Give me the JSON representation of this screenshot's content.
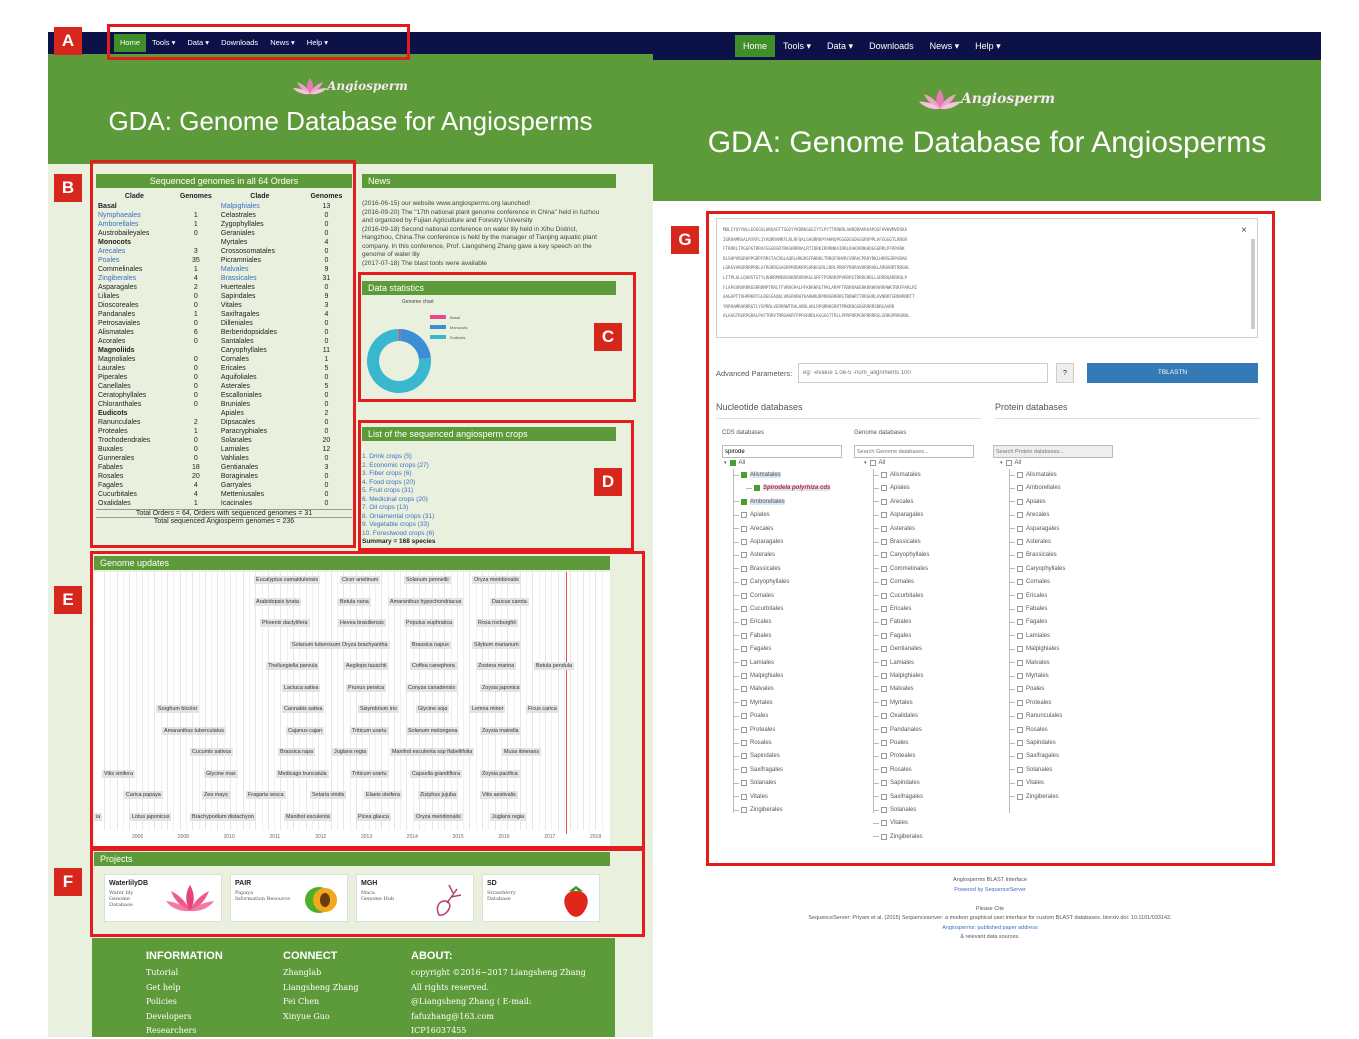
{
  "tags": [
    "A",
    "B",
    "C",
    "D",
    "E",
    "F",
    "G"
  ],
  "nav": {
    "items": [
      "Home",
      "Tools ▾",
      "Data ▾",
      "Downloads",
      "News ▾",
      "Help ▾"
    ],
    "active": "Home"
  },
  "header": {
    "logo_text": "Angiosperm",
    "title": "GDA: Genome Database for Angiosperms"
  },
  "genomes": {
    "title": "Sequenced genomes in all 64 Orders",
    "col_headers": [
      "Clade",
      "Genomes",
      "Clade",
      "Genomes"
    ],
    "left": [
      {
        "n": "Basal",
        "v": "",
        "type": "group"
      },
      {
        "n": "Nymphaeales",
        "v": "1",
        "type": "link"
      },
      {
        "n": "Amborellales",
        "v": "1",
        "type": "link"
      },
      {
        "n": "Austrobaileyales",
        "v": "0",
        "type": "plain"
      },
      {
        "n": "Monocots",
        "v": "",
        "type": "group"
      },
      {
        "n": "Arecales",
        "v": "3",
        "type": "link"
      },
      {
        "n": "Poales",
        "v": "35",
        "type": "link"
      },
      {
        "n": "Commelinales",
        "v": "1",
        "type": "plain"
      },
      {
        "n": "Zingiberales",
        "v": "4",
        "type": "link"
      },
      {
        "n": "Asparagales",
        "v": "2",
        "type": "plain"
      },
      {
        "n": "Liliales",
        "v": "0",
        "type": "plain"
      },
      {
        "n": "Dioscoreales",
        "v": "0",
        "type": "plain"
      },
      {
        "n": "Pandanales",
        "v": "1",
        "type": "plain"
      },
      {
        "n": "Petrosaviales",
        "v": "0",
        "type": "plain"
      },
      {
        "n": "Alismatales",
        "v": "6",
        "type": "plain"
      },
      {
        "n": "Acorales",
        "v": "0",
        "type": "plain"
      },
      {
        "n": "Magnoliids",
        "v": "",
        "type": "group"
      },
      {
        "n": "Magnoliales",
        "v": "0",
        "type": "plain"
      },
      {
        "n": "Laurales",
        "v": "0",
        "type": "plain"
      },
      {
        "n": "Piperales",
        "v": "0",
        "type": "plain"
      },
      {
        "n": "Canellales",
        "v": "0",
        "type": "plain"
      },
      {
        "n": "Ceratophyllales",
        "v": "0",
        "type": "plain"
      },
      {
        "n": "Chloranthales",
        "v": "0",
        "type": "plain"
      },
      {
        "n": "Eudicots",
        "v": "",
        "type": "group"
      },
      {
        "n": "Ranunculales",
        "v": "2",
        "type": "plain"
      },
      {
        "n": "Proteales",
        "v": "1",
        "type": "plain"
      },
      {
        "n": "Trochodendrales",
        "v": "0",
        "type": "plain"
      },
      {
        "n": "Buxales",
        "v": "0",
        "type": "plain"
      },
      {
        "n": "Gunnerales",
        "v": "0",
        "type": "plain"
      },
      {
        "n": "Fabales",
        "v": "18",
        "type": "plain"
      },
      {
        "n": "Rosales",
        "v": "20",
        "type": "plain"
      },
      {
        "n": "Fagales",
        "v": "4",
        "type": "plain"
      },
      {
        "n": "Cucurbitales",
        "v": "4",
        "type": "plain"
      },
      {
        "n": "Oxalidales",
        "v": "1",
        "type": "plain"
      }
    ],
    "right": [
      {
        "n": "Malpighiales",
        "v": "13",
        "type": "link"
      },
      {
        "n": "Celastrales",
        "v": "0",
        "type": "plain"
      },
      {
        "n": "Zygophyllales",
        "v": "0",
        "type": "plain"
      },
      {
        "n": "Geraniales",
        "v": "0",
        "type": "plain"
      },
      {
        "n": "Myrtales",
        "v": "4",
        "type": "plain"
      },
      {
        "n": "Crossosomatales",
        "v": "0",
        "type": "plain"
      },
      {
        "n": "Picramniales",
        "v": "0",
        "type": "plain"
      },
      {
        "n": "Malvales",
        "v": "9",
        "type": "link"
      },
      {
        "n": "Brassicales",
        "v": "31",
        "type": "link"
      },
      {
        "n": "Huerteales",
        "v": "0",
        "type": "plain"
      },
      {
        "n": "Sapindales",
        "v": "9",
        "type": "plain"
      },
      {
        "n": "Vitales",
        "v": "3",
        "type": "plain"
      },
      {
        "n": "Saxifragales",
        "v": "4",
        "type": "plain"
      },
      {
        "n": "Dilleniales",
        "v": "0",
        "type": "plain"
      },
      {
        "n": "Berberidopsidales",
        "v": "0",
        "type": "plain"
      },
      {
        "n": "Santalales",
        "v": "0",
        "type": "plain"
      },
      {
        "n": "Caryophyllales",
        "v": "11",
        "type": "plain"
      },
      {
        "n": "Cornales",
        "v": "1",
        "type": "plain"
      },
      {
        "n": "Ericales",
        "v": "5",
        "type": "plain"
      },
      {
        "n": "Aquifoliales",
        "v": "0",
        "type": "plain"
      },
      {
        "n": "Asterales",
        "v": "5",
        "type": "plain"
      },
      {
        "n": "Escalloniales",
        "v": "0",
        "type": "plain"
      },
      {
        "n": "Bruniales",
        "v": "0",
        "type": "plain"
      },
      {
        "n": "Apiales",
        "v": "2",
        "type": "plain"
      },
      {
        "n": "Dipsacales",
        "v": "0",
        "type": "plain"
      },
      {
        "n": "Paracryphiales",
        "v": "0",
        "type": "plain"
      },
      {
        "n": "Solanales",
        "v": "20",
        "type": "plain"
      },
      {
        "n": "Lamiales",
        "v": "12",
        "type": "plain"
      },
      {
        "n": "Vahliales",
        "v": "0",
        "type": "plain"
      },
      {
        "n": "Gentianales",
        "v": "3",
        "type": "plain"
      },
      {
        "n": "Boraginales",
        "v": "0",
        "type": "plain"
      },
      {
        "n": "Garryales",
        "v": "0",
        "type": "plain"
      },
      {
        "n": "Metteniusales",
        "v": "0",
        "type": "plain"
      },
      {
        "n": "Icacinales",
        "v": "0",
        "type": "plain"
      }
    ],
    "total_orders": "Total Orders = 64, Orders with sequenced genomes = 31",
    "total_genomes": "Total sequenced Angiosperm genomes = 236"
  },
  "news": {
    "title": "News",
    "lines": [
      "(2016-06-15) our website www.angiosperms.org launched!",
      "(2016-09-20) The \"17th national plant genome conference in China\" held in fuzhou",
      "and organized by Fujian Agriculture and Forestry University",
      "(2016-09-18) Second national conference on water lily held in Xihu District,",
      "Hangzhou, China.The conference is held by the manager of Tianjing aquatic plant",
      "company. In this conference, Prof. Liangsheng Zhang gave a key speech on the",
      "genome of water lily",
      "(2017-07-18) The blast tools were available"
    ]
  },
  "stats": {
    "title": "Data statistics",
    "chart_title": "Genome chart",
    "legend": [
      "Basal",
      "Monocots",
      "Eudicots"
    ]
  },
  "chart_data": {
    "type": "pie",
    "title": "Genome chart",
    "labels": [
      "Basal",
      "Monocots",
      "Eudicots"
    ],
    "values": [
      2,
      52,
      176
    ],
    "colors": [
      "#e8488a",
      "#3a8fd6",
      "#39b7cf"
    ]
  },
  "crops": {
    "title": "List of the sequenced angiosperm crops",
    "items": [
      "1. Drink crops (5)",
      "2. Economic crops (27)",
      "3. Fiber crops (6)",
      "4. Food crops (20)",
      "5. Fruit crops (31)",
      "6. Medicinal crops (20)",
      "7. Oil crops (13)",
      "8. Ornamental crops (31)",
      "9. Vegetable crops (33)",
      "10. Forestwood crops (6)"
    ],
    "summary": "Summary = 168 species"
  },
  "updates": {
    "title": "Genome updates",
    "species": [
      "Eucalyptus camaldulensis",
      "Cicer arietinum",
      "Solanum pennellii",
      "Oryza meridionalis",
      "Arabidopsis lyrata",
      "Betula nana",
      "Amaranthus hypochondriacus",
      "Daucus carota",
      "Phoenix dactylifera",
      "Hevea brasiliensis",
      "Populus euphratica",
      "Rosa roxburghii",
      "Solanum tuberosum",
      "Oryza brachyantha",
      "Brassica napus",
      "Silybum marianum",
      "Thellungiella parvula",
      "Aegilops tauschii",
      "Coffea canephora",
      "Zostera marina",
      "Betula pendula",
      "Lactuca sativa",
      "Prunus persica",
      "Conyza canadensis",
      "Zoysia japonica",
      "Sorghum bicolor",
      "Cannabis sativa",
      "Sisymbrium irio",
      "Glycine soja",
      "Lemna minor",
      "Ficus carica",
      "Amaranthus tuberculatus",
      "Cajanus cajan",
      "Triticum urartu",
      "Solanum melongena",
      "Zoysia matrella",
      "Cucumis sativus",
      "Brassica rapa",
      "Juglans regia",
      "Manihot esculenta ssp flabellifolia",
      "Musa itinerans",
      "Vitis vinifera",
      "Glycine max",
      "Medicago truncatula",
      "Triticum urartu",
      "Capsella grandiflora",
      "Zoysia pacifica",
      "Carica papaya",
      "Zea mays",
      "Fragaria vesca",
      "Setaria viridis",
      "Elaeis oleifera",
      "Ziziphus jujuba",
      "Vitis aestivalis",
      "ia",
      "Lotus japonicus",
      "Brachypodium distachyon",
      "Manihot esculenta",
      "Picea glauca",
      "Oryza meridionalis",
      "Juglans regia"
    ],
    "years": [
      "2006",
      "2008",
      "2010",
      "2011",
      "2012",
      "2013",
      "2014",
      "2015",
      "2016",
      "2017",
      "2018"
    ]
  },
  "projects": {
    "title": "Projects",
    "items": [
      {
        "name": "WaterlilyDB",
        "desc": "Water lily\nGenome\nDatabase",
        "icon": "lotus-icon"
      },
      {
        "name": "PAIR",
        "desc": "Papaya\nInformation Resource",
        "icon": "papaya-icon"
      },
      {
        "name": "MGH",
        "desc": "Maca\nGenome Hub",
        "icon": "maca-icon"
      },
      {
        "name": "SD",
        "desc": "Strawberry\nDatabase",
        "icon": "strawberry-icon"
      }
    ]
  },
  "footer": {
    "info_title": "INFORMATION",
    "info": [
      "Tutorial",
      "Get help",
      "Policies",
      "Developers",
      "Researchers"
    ],
    "connect_title": "CONNECT",
    "connect": [
      "Zhanglab",
      "Liangsheng Zhang",
      "Fei Chen",
      "Xinyue Guo"
    ],
    "about_title": "ABOUT:",
    "about": [
      "copyright ©2016~2017 Liangsheng Zhang",
      "All rights reserved.",
      "@Liangsheng Zhang ( E-mail: fafuzhang@163.com",
      "ICP16037455"
    ]
  },
  "blast": {
    "sequence_lines": [
      "MDLIYQYYWLLEDGGSLHRQAGTTSGDYYKDRKGGEIYTLPYTTRRKRLAHRQRAKRAAPQSFHVHVMVDSKA",
      "IGRRAMRSALRYRFLIYAQRRAMRFLRLRFQALGAQRRKPYAHRQPGGGDGGDGGGRVPPLAFGGGGTLRRGR",
      "FTRRRLTPGGPGTRRAFGGGDGRTRKGRRRRALRTIDRKIRPRNKAIRRLRAKVRRKHDGGGRRLPFRPARK",
      "DLSHPVRGRHPPGRPFRRSTACRGLAQRLHRGRSFRHRKLTRRQFRHVRCVRRACPRRYRKLHRRSGRPGRAK",
      "LGRGVVRGRRRPRRLATRGRRGGAGRPRRDKRPSARKGGRLLRRLPRRPYRRRAVRRRRAKLARRARRTRRGRL",
      "LFTPLALLQARSTGTYLRHRRMRRRSRKRRVRVKGLSRFFPSRRRPPVRRPGTRRRGRRLLSRRRQARRRQLP",
      "FLAPGVRVRRRGSRRRMPTRRLTFVRRGPALPFKRRHRGTPKLARPFTRRRRAKERKRRHRARRPWKTRRFPARLRI",
      "AAGAPTTVHPRKRTGLREGSAQKLVRGRVRHTKARWRQRPRRGRRRRSTRRWRTTRRGRRLAVNRRTGRRRRRRTT",
      "YRPRAMRARRRGTLYGPRRLVERRRWTRALARRLARLRPQRRKGRRTPRKRRGGRGRRRRSRRGAVRR",
      "ALAAGTRGRPGRALPAFTRRVTRRGAKRTPPPGRRRLKGGGGTTRLLPPRPRRPGRPRRRRSLGRRGPRRGRRL"
    ],
    "adv_label": "Advanced Parameters:",
    "adv_placeholder": "eg: -evalue 1.0e-5 -num_alignments 100",
    "help_q": "?",
    "submit": "TBLASTN",
    "close": "×",
    "nuc_title": "Nucleotide databases",
    "prot_title": "Protein databases",
    "cds_title": "CDS databases",
    "genome_title": "Genome databases",
    "cds_search_value": "spirode",
    "genome_search_placeholder": "Search Genome databases...",
    "protein_search_placeholder": "Search Protein databases...",
    "root": "All",
    "cds_tree": [
      "Alismatales",
      "Spirodela polyrhiza cds",
      "Amborellales",
      "Apiales",
      "Arecales",
      "Asparagales",
      "Asterales",
      "Brassicales",
      "Caryophyllales",
      "Cornales",
      "Cucurbitales",
      "Ericales",
      "Fabales",
      "Fagales",
      "Lamiales",
      "Malpighiales",
      "Malvales",
      "Myrtales",
      "Poales",
      "Proteales",
      "Rosales",
      "Sapindales",
      "Saxifragales",
      "Solanales",
      "Vitales",
      "Zingiberales"
    ],
    "genome_tree": [
      "Alismatales",
      "Apiales",
      "Arecales",
      "Asparagales",
      "Asterales",
      "Brassicales",
      "Caryophyllales",
      "Commelinales",
      "Cornales",
      "Cucurbitales",
      "Ericales",
      "Fabales",
      "Fagales",
      "Gentianales",
      "Lamiales",
      "Malpighiales",
      "Malvales",
      "Myrtales",
      "Oxalidales",
      "Pandanales",
      "Poales",
      "Proteales",
      "Rosales",
      "Sapindales",
      "Saxifragales",
      "Solanales",
      "Vitales",
      "Zingiberales"
    ],
    "protein_tree": [
      "Alismatales",
      "Amborellales",
      "Apiales",
      "Arecales",
      "Asparagales",
      "Asterales",
      "Brassicales",
      "Caryophyllales",
      "Cornales",
      "Ericales",
      "Fabales",
      "Fagales",
      "Lamiales",
      "Malpighiales",
      "Malvales",
      "Myrtales",
      "Poales",
      "Proteales",
      "Ranunculales",
      "Rosales",
      "Sapindales",
      "Saxifragales",
      "Solanales",
      "Vitales",
      "Zingiberales"
    ],
    "footer_lines": [
      "Angiosperms BLAST Interface",
      "Powered by SequenceServer",
      "",
      "Please Cite",
      "SequenceServer: Priyam et al. (2015) Sequenceserver: a modern graphical user interface for custom BLAST databases. biorxiv doi: 10.1101/033142.",
      "Angiosperms: published paper address",
      "& relevant data sources."
    ]
  }
}
